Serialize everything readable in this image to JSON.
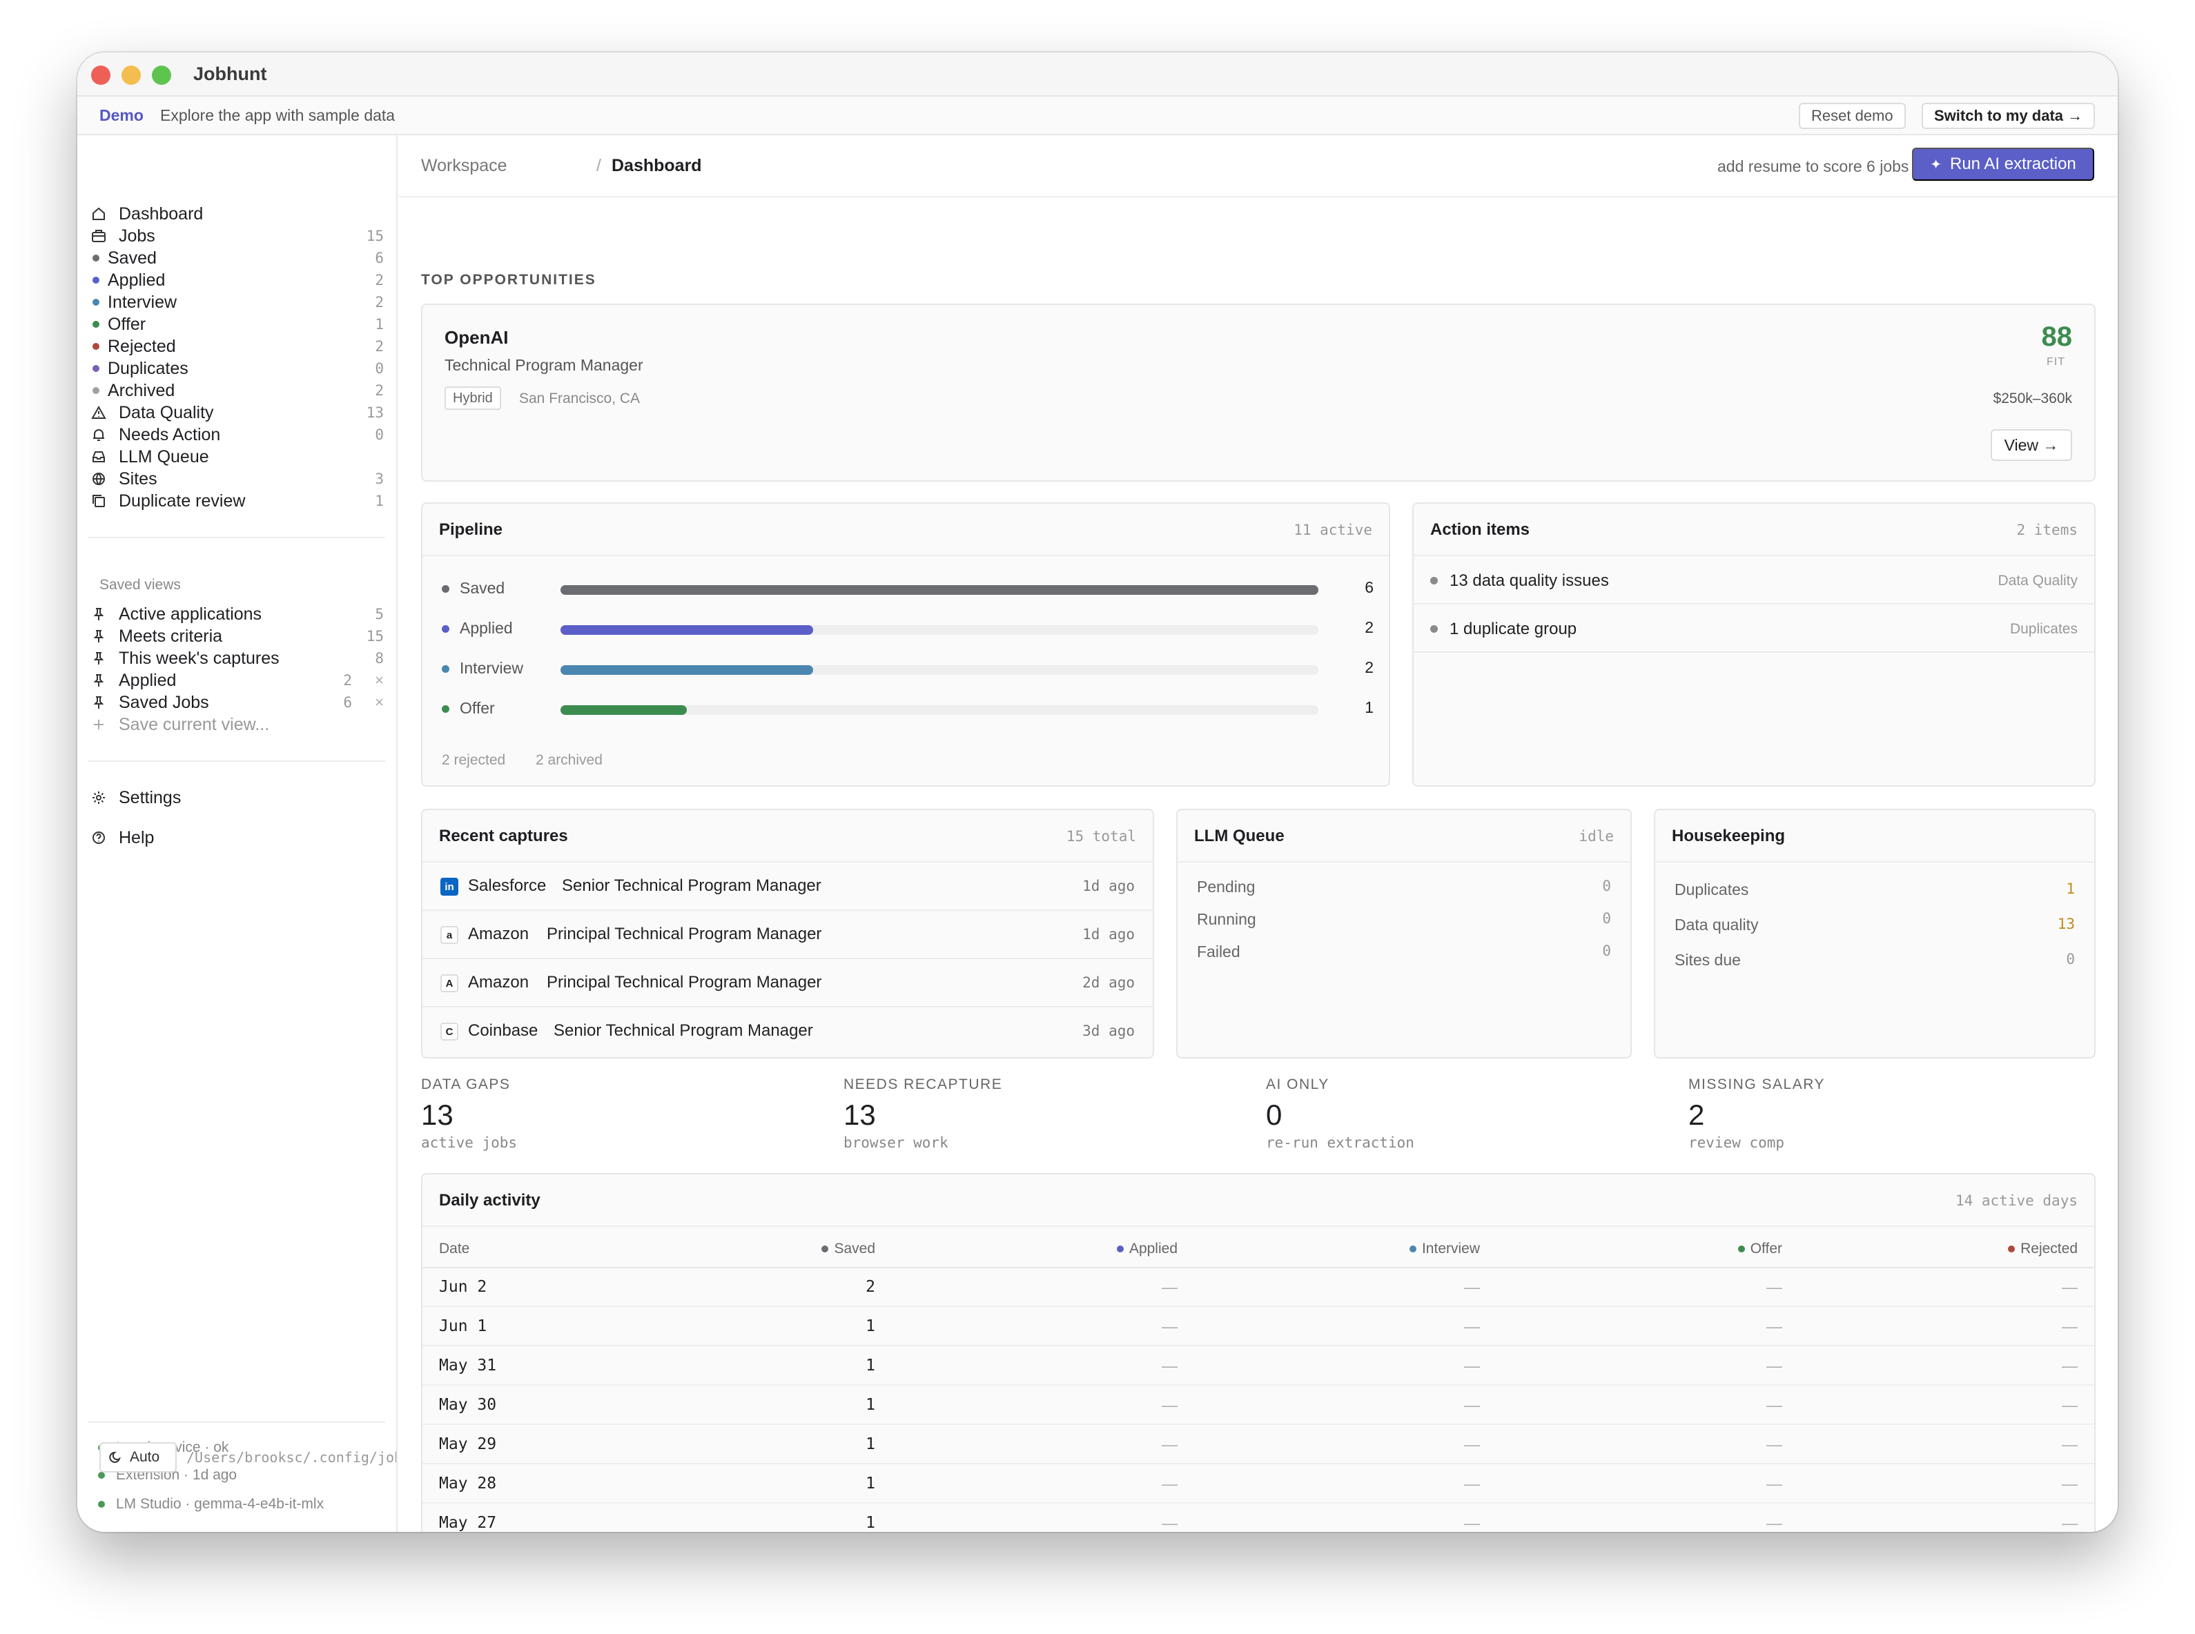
{
  "window": {
    "title": "Jobhunt"
  },
  "demo": {
    "label": "Demo",
    "text": "Explore the app with sample data",
    "reset_label": "Reset demo",
    "switch_label": "Switch to my data →"
  },
  "sidebar": {
    "nav": [
      {
        "label": "Dashboard",
        "count": "",
        "icon": "home-icon"
      },
      {
        "label": "Jobs",
        "count": "15",
        "icon": "briefcase-icon"
      },
      {
        "label": "Saved",
        "count": "6",
        "dot": "#6b6b72"
      },
      {
        "label": "Applied",
        "count": "2",
        "dot": "#5b5fc7"
      },
      {
        "label": "Interview",
        "count": "2",
        "dot": "#4a86b0"
      },
      {
        "label": "Offer",
        "count": "1",
        "dot": "#3d8c4f"
      },
      {
        "label": "Rejected",
        "count": "2",
        "dot": "#b0473e"
      },
      {
        "label": "Duplicates",
        "count": "0",
        "dot": "#7a5fb5"
      },
      {
        "label": "Archived",
        "count": "2",
        "dot": "#a0a0a0"
      },
      {
        "label": "Data Quality",
        "count": "13",
        "icon": "warning-icon"
      },
      {
        "label": "Needs Action",
        "count": "0",
        "icon": "bell-icon"
      },
      {
        "label": "LLM Queue",
        "count": "",
        "icon": "inbox-icon"
      },
      {
        "label": "Sites",
        "count": "3",
        "icon": "globe-icon"
      },
      {
        "label": "Duplicate review",
        "count": "1",
        "icon": "copy-icon"
      }
    ],
    "saved_views_title": "Saved views",
    "saved_views": [
      {
        "label": "Active applications",
        "count": "5",
        "removable": false
      },
      {
        "label": "Meets criteria",
        "count": "15",
        "removable": false
      },
      {
        "label": "This week's captures",
        "count": "8",
        "removable": false
      },
      {
        "label": "Applied",
        "count": "2",
        "removable": true
      },
      {
        "label": "Saved Jobs",
        "count": "6",
        "removable": true
      }
    ],
    "save_current_label": "Save current view...",
    "remove_symbol": "×",
    "settings_label": "Settings",
    "help_label": "Help",
    "status": [
      {
        "text": "Local service · ok"
      },
      {
        "text": "Extension · 1d ago"
      },
      {
        "text": "LM Studio · gemma-4-e4b-it-mlx"
      }
    ],
    "theme_label": "Auto",
    "config_path": "/Users/brooksc/.config/jobhunt"
  },
  "header": {
    "breadcrumb_root": "Workspace",
    "breadcrumb_sep": "/",
    "breadcrumb_current": "Dashboard",
    "resume_note": "add resume to score 6 jobs",
    "run_label": "Run AI extraction"
  },
  "top_opportunities": {
    "title": "TOP OPPORTUNITIES",
    "company": "OpenAI",
    "role": "Technical Program Manager",
    "tag": "Hybrid",
    "location": "San Francisco, CA",
    "score": "88",
    "score_label": "FIT",
    "salary": "$250k–360k",
    "view_label": "View →"
  },
  "pipeline": {
    "title": "Pipeline",
    "meta": "11 active",
    "max": 6,
    "rows": [
      {
        "label": "Saved",
        "value": 6,
        "color": "#6b6b72"
      },
      {
        "label": "Applied",
        "value": 2,
        "color": "#5b5fc7"
      },
      {
        "label": "Interview",
        "value": 2,
        "color": "#4a86b0"
      },
      {
        "label": "Offer",
        "value": 1,
        "color": "#3d8c4f"
      }
    ],
    "rejected": "2 rejected",
    "archived": "2 archived"
  },
  "action_items": {
    "title": "Action items",
    "meta": "2 items",
    "items": [
      {
        "label": "13 data quality issues",
        "tag": "Data Quality"
      },
      {
        "label": "1 duplicate group",
        "tag": "Duplicates"
      }
    ]
  },
  "recent_captures": {
    "title": "Recent captures",
    "meta": "15 total",
    "items": [
      {
        "logo": "in",
        "company": "Salesforce",
        "title": "Senior Technical Program Manager",
        "ago": "1d ago"
      },
      {
        "logo": "a",
        "company": "Amazon",
        "title": "Principal Technical Program Manager",
        "ago": "1d ago"
      },
      {
        "logo": "A",
        "company": "Amazon",
        "title": "Principal Technical Program Manager",
        "ago": "2d ago"
      },
      {
        "logo": "C",
        "company": "Coinbase",
        "title": "Senior Technical Program Manager",
        "ago": "3d ago"
      }
    ]
  },
  "llm_queue": {
    "title": "LLM Queue",
    "meta": "idle",
    "rows": [
      {
        "label": "Pending",
        "value": "0"
      },
      {
        "label": "Running",
        "value": "0"
      },
      {
        "label": "Failed",
        "value": "0"
      }
    ]
  },
  "housekeeping": {
    "title": "Housekeeping",
    "rows": [
      {
        "label": "Duplicates",
        "value": "1",
        "warn": true
      },
      {
        "label": "Data quality",
        "value": "13",
        "warn": true
      },
      {
        "label": "Sites due",
        "value": "0",
        "warn": false
      }
    ]
  },
  "stats": [
    {
      "label": "DATA GAPS",
      "value": "13",
      "sub": "active jobs"
    },
    {
      "label": "NEEDS RECAPTURE",
      "value": "13",
      "sub": "browser work"
    },
    {
      "label": "AI ONLY",
      "value": "0",
      "sub": "re-run extraction"
    },
    {
      "label": "MISSING SALARY",
      "value": "2",
      "sub": "review comp"
    }
  ],
  "daily_activity": {
    "title": "Daily activity",
    "meta": "14 active days",
    "columns": [
      {
        "label": "Date"
      },
      {
        "label": "Saved",
        "dot": "#6b6b72"
      },
      {
        "label": "Applied",
        "dot": "#5b5fc7"
      },
      {
        "label": "Interview",
        "dot": "#4a86b0"
      },
      {
        "label": "Offer",
        "dot": "#3d8c4f"
      },
      {
        "label": "Rejected",
        "dot": "#b0473e"
      }
    ],
    "rows": [
      {
        "date": "Jun 2",
        "saved": "2",
        "applied": "—",
        "interview": "—",
        "offer": "—",
        "rejected": "—"
      },
      {
        "date": "Jun 1",
        "saved": "1",
        "applied": "—",
        "interview": "—",
        "offer": "—",
        "rejected": "—"
      },
      {
        "date": "May 31",
        "saved": "1",
        "applied": "—",
        "interview": "—",
        "offer": "—",
        "rejected": "—"
      },
      {
        "date": "May 30",
        "saved": "1",
        "applied": "—",
        "interview": "—",
        "offer": "—",
        "rejected": "—"
      },
      {
        "date": "May 29",
        "saved": "1",
        "applied": "—",
        "interview": "—",
        "offer": "—",
        "rejected": "—"
      },
      {
        "date": "May 28",
        "saved": "1",
        "applied": "—",
        "interview": "—",
        "offer": "—",
        "rejected": "—"
      },
      {
        "date": "May 27",
        "saved": "1",
        "applied": "—",
        "interview": "—",
        "offer": "—",
        "rejected": "—"
      }
    ]
  }
}
